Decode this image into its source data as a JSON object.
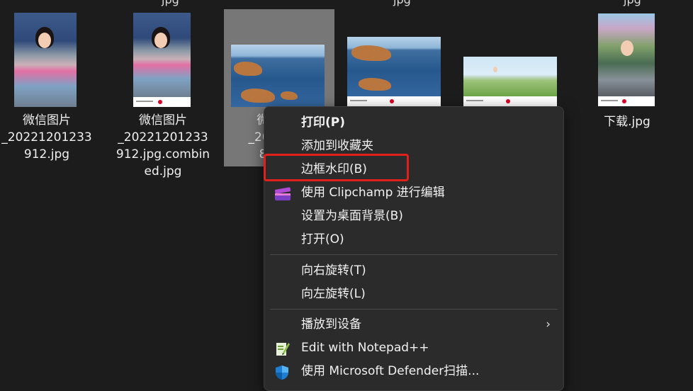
{
  "files": [
    {
      "name": "微信图片\n_20221201233\n912.jpg"
    },
    {
      "name": "微信图片\n_20221201233\n912.jpg.combin\ned.jpg"
    },
    {
      "name": "微\n_202\n8"
    },
    {
      "name": ""
    },
    {
      "name": ""
    },
    {
      "name": "下载.jpg"
    }
  ],
  "top_fragments": [
    "jpg",
    "jpg",
    "jpg"
  ],
  "context_menu": {
    "items": [
      {
        "label": "打印(P)",
        "bold": true
      },
      {
        "label": "添加到收藏夹"
      },
      {
        "label": "边框水印(B)",
        "highlighted": true
      },
      {
        "label": "使用 Clipchamp 进行编辑",
        "icon": "clipchamp-icon"
      },
      {
        "label": "设置为桌面背景(B)"
      },
      {
        "label": "打开(O)"
      },
      {
        "label": "向右旋转(T)"
      },
      {
        "label": "向左旋转(L)"
      },
      {
        "label": "播放到设备",
        "submenu_arrow": "›"
      },
      {
        "label": "Edit with Notepad++",
        "icon": "notepadpp-icon"
      },
      {
        "label": "使用 Microsoft Defender扫描...",
        "icon": "defender-shield-icon"
      }
    ]
  },
  "colors": {
    "background": "#1c1c1c",
    "menu_background": "#2b2b2b",
    "highlight_border": "#e0201b",
    "selected_tile": "#777777"
  }
}
